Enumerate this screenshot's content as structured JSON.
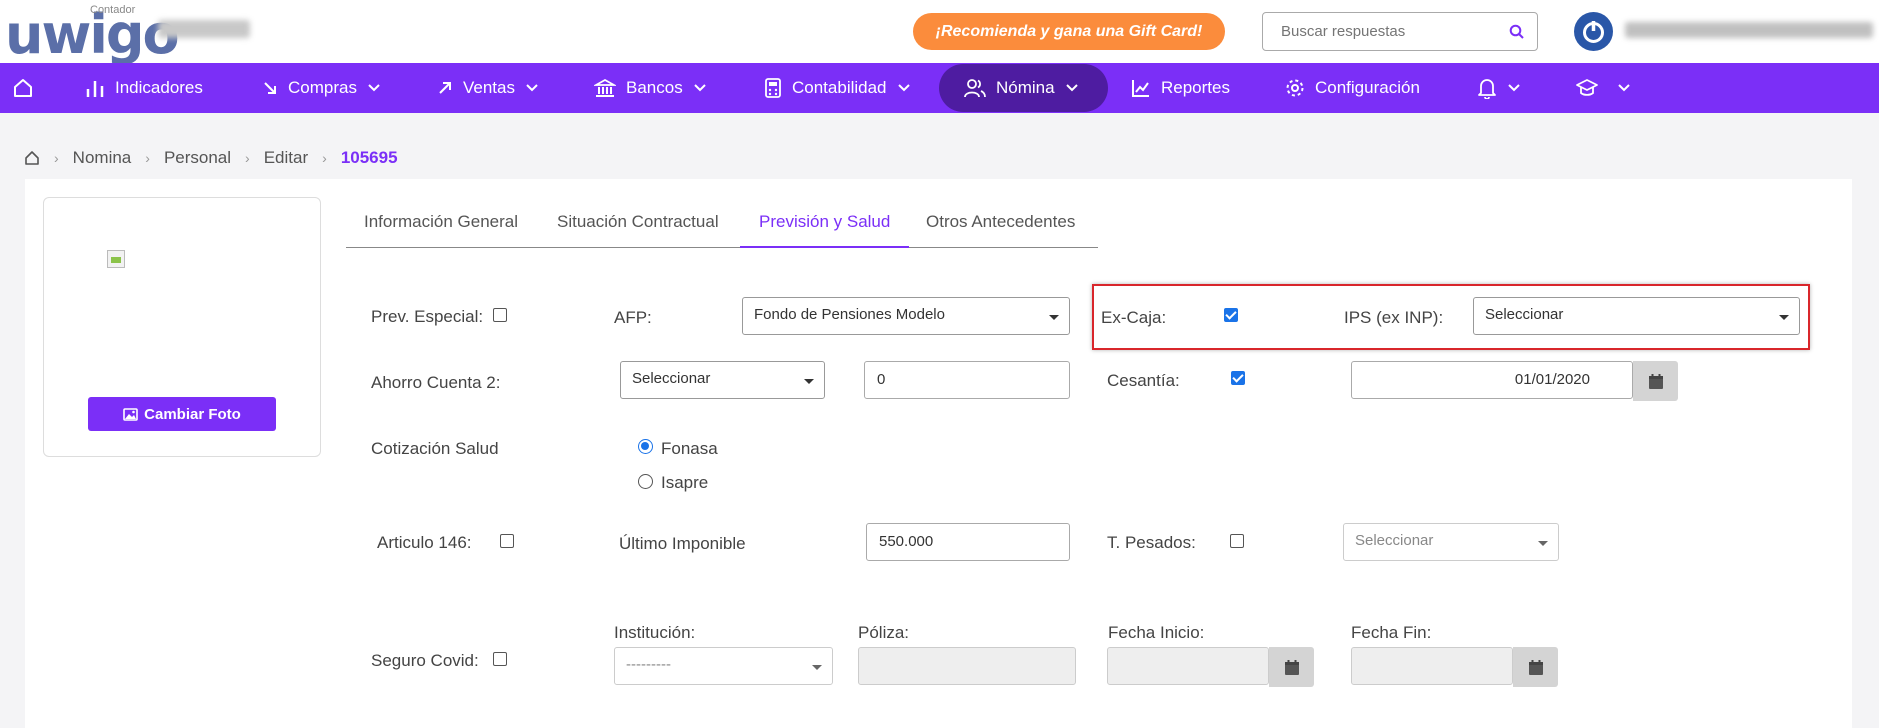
{
  "header": {
    "logo_text": "uwigo",
    "logo_sub": "Contador",
    "promo": "¡Recomienda y gana una Gift Card!",
    "search_placeholder": "Buscar respuestas"
  },
  "nav": {
    "items": [
      {
        "label": "Indicadores"
      },
      {
        "label": "Compras"
      },
      {
        "label": "Ventas"
      },
      {
        "label": "Bancos"
      },
      {
        "label": "Contabilidad"
      },
      {
        "label": "Nómina"
      },
      {
        "label": "Reportes"
      },
      {
        "label": "Configuración"
      }
    ],
    "accent": "#7b2ff7",
    "active_bg": "#4e1ca1"
  },
  "breadcrumb": [
    "Nomina",
    "Personal",
    "Editar",
    "105695"
  ],
  "photo": {
    "button": "Cambiar Foto"
  },
  "tabs": [
    "Información General",
    "Situación Contractual",
    "Previsión y Salud",
    "Otros Antecedentes"
  ],
  "form": {
    "prev_especial": {
      "label": "Prev. Especial:",
      "checked": false
    },
    "afp": {
      "label": "AFP:",
      "value": "Fondo de Pensiones Modelo"
    },
    "ex_caja": {
      "label": "Ex-Caja:",
      "checked": true
    },
    "ips": {
      "label": "IPS (ex INP):",
      "value": "Seleccionar"
    },
    "ahorro": {
      "label": "Ahorro Cuenta 2:",
      "select": "Seleccionar",
      "amount": "0"
    },
    "cesantia": {
      "label": "Cesantía:",
      "checked": true,
      "date": "01/01/2020"
    },
    "cotizacion": {
      "label": "Cotización Salud",
      "options": [
        "Fonasa",
        "Isapre"
      ],
      "selected": "Fonasa"
    },
    "articulo146": {
      "label": "Articulo 146:",
      "checked": false
    },
    "ultimo_imponible": {
      "label": "Último Imponible",
      "value": "550.000"
    },
    "t_pesados": {
      "label": "T. Pesados:",
      "checked": false,
      "select": "Seleccionar"
    },
    "seguro_covid": {
      "label": "Seguro Covid:",
      "checked": false
    },
    "institucion": {
      "label": "Institución:",
      "value": "---------"
    },
    "poliza": {
      "label": "Póliza:"
    },
    "fecha_inicio": {
      "label": "Fecha Inicio:"
    },
    "fecha_fin": {
      "label": "Fecha Fin:"
    }
  }
}
